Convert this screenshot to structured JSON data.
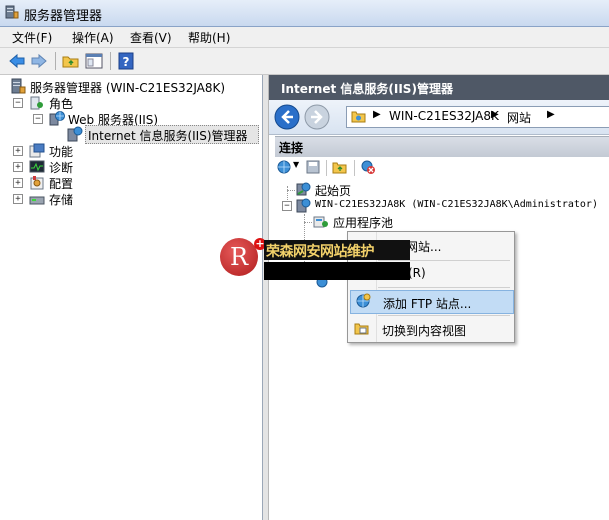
{
  "window": {
    "title": "服务器管理器"
  },
  "menu": {
    "items": [
      "文件(F)",
      "操作(A)",
      "查看(V)",
      "帮助(H)"
    ]
  },
  "tree": {
    "root": "服务器管理器 (WIN-C21ES32JA8K)",
    "roles": "角色",
    "web_server": "Web 服务器(IIS)",
    "iis_manager": "Internet 信息服务(IIS)管理器",
    "features": "功能",
    "diagnostics": "诊断",
    "configuration": "配置",
    "storage": "存储"
  },
  "iis": {
    "header": "Internet 信息服务(IIS)管理器",
    "breadcrumb": [
      "WIN-C21ES32JA8K",
      "网站"
    ],
    "connections_label": "连接",
    "start_page": "起始页",
    "server_node": "WIN-C21ES32JA8K (WIN-C21ES32JA8K\\Administrator)",
    "app_pools": "应用程序池"
  },
  "context_menu": {
    "add_website_partial": "网站...",
    "refresh_partial": "(R)",
    "add_ftp_site": "添加 FTP 站点...",
    "switch_content_view": "切换到内容视图"
  },
  "watermark": {
    "text": "荣森网安网站维护",
    "logo_letter": "R"
  },
  "colors": {
    "header_bg": "#4f5866",
    "highlight": "#c2dcf5",
    "accent_blue": "#2a6fc9"
  }
}
